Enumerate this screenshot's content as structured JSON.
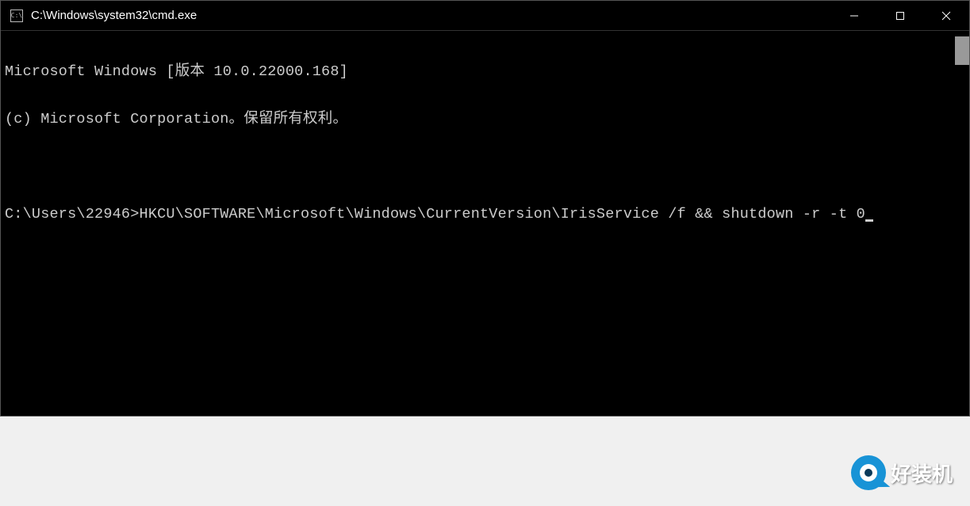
{
  "titlebar": {
    "icon_glyph": "C:\\",
    "path": "C:\\Windows\\system32\\cmd.exe"
  },
  "terminal": {
    "line1": "Microsoft Windows [版本 10.0.22000.168]",
    "line2": "(c) Microsoft Corporation。保留所有权利。",
    "prompt": "C:\\Users\\22946>",
    "command": "HKCU\\SOFTWARE\\Microsoft\\Windows\\CurrentVersion\\IrisService /f && shutdown -r -t 0"
  },
  "watermark": {
    "text": "好装机"
  }
}
